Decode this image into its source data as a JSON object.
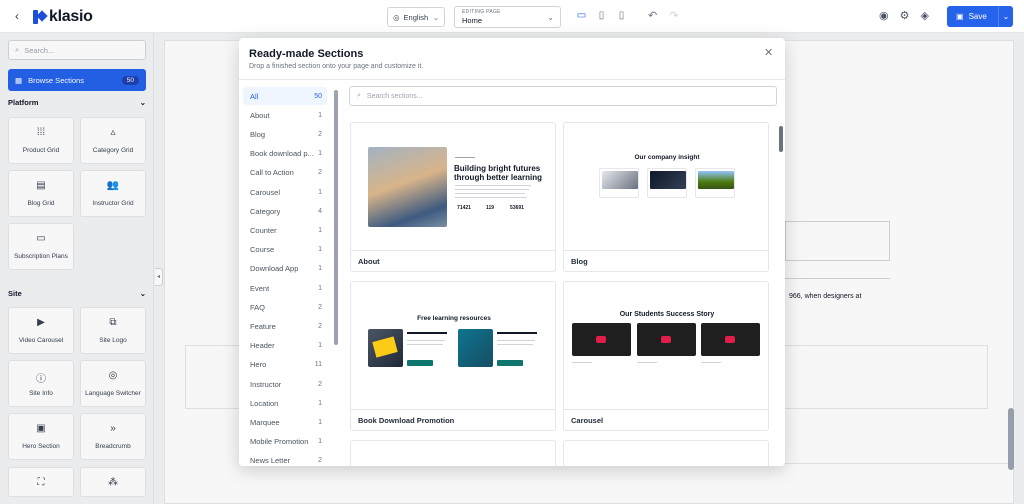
{
  "app": {
    "logo_text": "klasio",
    "brand_color": "#2563eb"
  },
  "topbar": {
    "language": "English",
    "editing_caption": "EDITING PAGE",
    "editing_value": "Home",
    "save_label": "Save"
  },
  "sidebar": {
    "search_placeholder": "Search...",
    "browse_label": "Browse Sections",
    "browse_count": "50",
    "platform_title": "Platform",
    "site_title": "Site",
    "platform_items": [
      {
        "label": "Product Grid",
        "icon": "grid-dots-icon"
      },
      {
        "label": "Category Grid",
        "icon": "shapes-icon"
      },
      {
        "label": "Blog Grid",
        "icon": "document-icon"
      },
      {
        "label": "Instructor Grid",
        "icon": "users-icon"
      },
      {
        "label": "Subscription Plans",
        "icon": "card-icon"
      }
    ],
    "site_items": [
      {
        "label": "Video Carousel",
        "icon": "video-icon"
      },
      {
        "label": "Site Logo",
        "icon": "logo-icon"
      },
      {
        "label": "Site Info",
        "icon": "info-icon"
      },
      {
        "label": "Language Switcher",
        "icon": "globe-icon"
      },
      {
        "label": "Hero Section",
        "icon": "hero-icon"
      },
      {
        "label": "Breadcrumb",
        "icon": "breadcrumb-icon"
      }
    ]
  },
  "canvas": {
    "text_fragment": "966, when designers at"
  },
  "modal": {
    "title": "Ready-made Sections",
    "subtitle": "Drop a finished section onto your page and customize it.",
    "search_placeholder": "Search sections...",
    "categories": [
      {
        "name": "All",
        "count": "50"
      },
      {
        "name": "About",
        "count": "1"
      },
      {
        "name": "Blog",
        "count": "2"
      },
      {
        "name": "Book download p...",
        "count": "1"
      },
      {
        "name": "Call to Action",
        "count": "2"
      },
      {
        "name": "Carousel",
        "count": "1"
      },
      {
        "name": "Category",
        "count": "4"
      },
      {
        "name": "Counter",
        "count": "1"
      },
      {
        "name": "Course",
        "count": "1"
      },
      {
        "name": "Download App",
        "count": "1"
      },
      {
        "name": "Event",
        "count": "1"
      },
      {
        "name": "FAQ",
        "count": "2"
      },
      {
        "name": "Feature",
        "count": "2"
      },
      {
        "name": "Header",
        "count": "1"
      },
      {
        "name": "Hero",
        "count": "11"
      },
      {
        "name": "Instructor",
        "count": "2"
      },
      {
        "name": "Location",
        "count": "1"
      },
      {
        "name": "Marquee",
        "count": "1"
      },
      {
        "name": "Mobile Promotion",
        "count": "1"
      },
      {
        "name": "News Letter",
        "count": "2"
      }
    ],
    "cards": [
      {
        "label": "About",
        "preview_title": "Building bright futures through better learning",
        "stats": [
          "71421",
          "119",
          "53691"
        ]
      },
      {
        "label": "Blog",
        "preview_title": "Our company insight"
      },
      {
        "label": "Book Download Promotion",
        "preview_title": "Free learning resources",
        "items": [
          "English Fluency Practice Book",
          "Explore Courses & Programs"
        ]
      },
      {
        "label": "Carousel",
        "preview_title": "Our Students Success Story"
      }
    ]
  }
}
